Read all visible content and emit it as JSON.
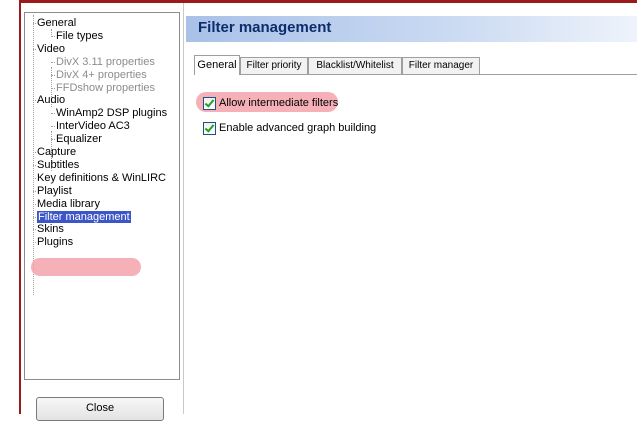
{
  "tree": {
    "items": [
      {
        "label": "General",
        "level": 0,
        "state": "normal"
      },
      {
        "label": "File types",
        "level": 1,
        "state": "normal"
      },
      {
        "label": "Video",
        "level": 0,
        "state": "normal"
      },
      {
        "label": "DivX 3.11 properties",
        "level": 1,
        "state": "disabled"
      },
      {
        "label": "DivX 4+ properties",
        "level": 1,
        "state": "disabled"
      },
      {
        "label": "FFDshow properties",
        "level": 1,
        "state": "disabled"
      },
      {
        "label": "Audio",
        "level": 0,
        "state": "normal"
      },
      {
        "label": "WinAmp2 DSP plugins",
        "level": 1,
        "state": "normal"
      },
      {
        "label": "InterVideo AC3",
        "level": 1,
        "state": "normal"
      },
      {
        "label": "Equalizer",
        "level": 1,
        "state": "normal"
      },
      {
        "label": "Capture",
        "level": 0,
        "state": "normal"
      },
      {
        "label": "Subtitles",
        "level": 0,
        "state": "normal"
      },
      {
        "label": "Key definitions & WinLIRC",
        "level": 0,
        "state": "normal"
      },
      {
        "label": "Playlist",
        "level": 0,
        "state": "normal"
      },
      {
        "label": "Media library",
        "level": 0,
        "state": "normal"
      },
      {
        "label": "Filter management",
        "level": 0,
        "state": "selected"
      },
      {
        "label": "Skins",
        "level": 0,
        "state": "normal"
      },
      {
        "label": "Plugins",
        "level": 0,
        "state": "normal"
      }
    ]
  },
  "close_button": "Close",
  "page_title": "Filter management",
  "tabs": [
    {
      "label": "General",
      "active": true
    },
    {
      "label": "Filter priority",
      "active": false
    },
    {
      "label": "Blacklist/Whitelist",
      "active": false
    },
    {
      "label": "Filter manager",
      "active": false
    }
  ],
  "options": [
    {
      "label": "Allow intermediate filters",
      "checked": true,
      "highlighted": true
    },
    {
      "label": "Enable advanced graph building",
      "checked": true,
      "highlighted": false
    }
  ],
  "colors": {
    "frame": "#9b1b1b",
    "selection": "#3c56c8",
    "highlight": "#f4a3ab",
    "title_text": "#0c2d6b"
  }
}
